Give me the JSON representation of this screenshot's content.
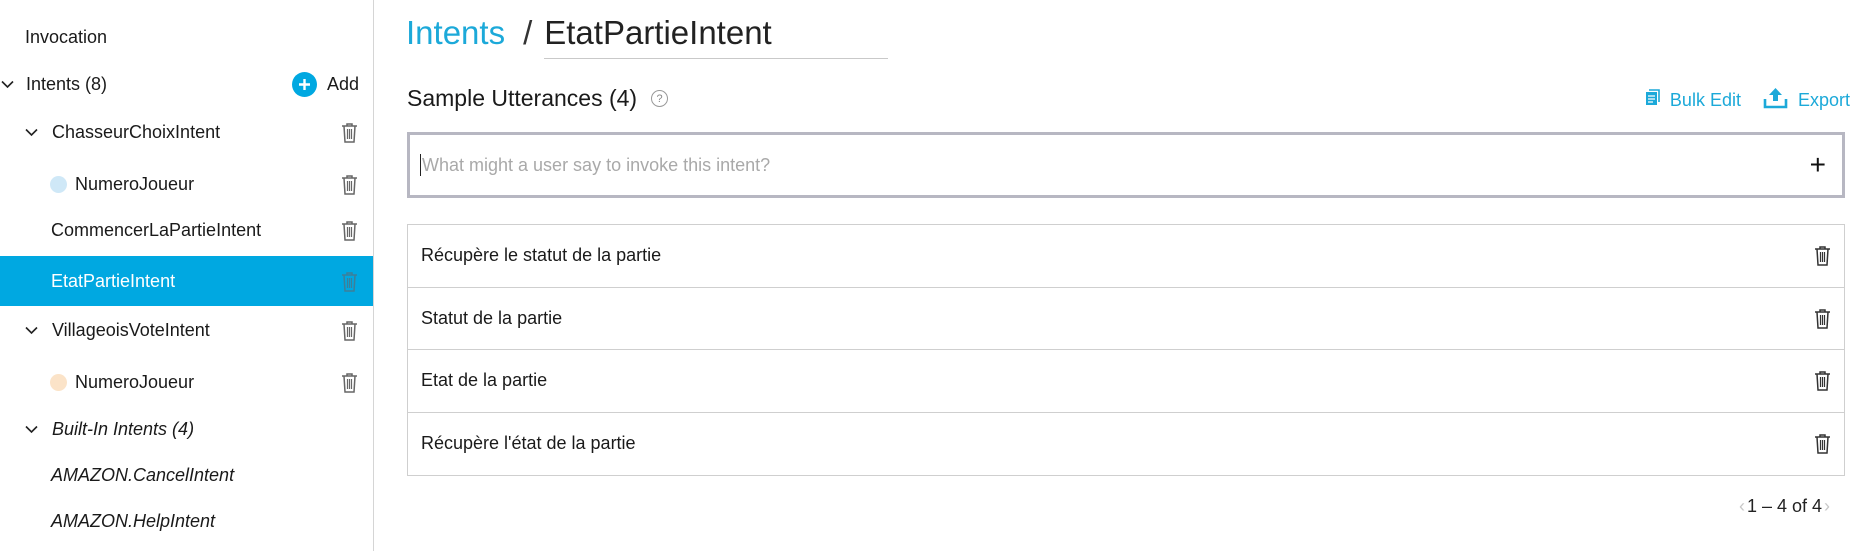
{
  "sidebar": {
    "invocation_label": "Invocation",
    "intents_label": "Intents (8)",
    "add_label": "Add",
    "items": [
      {
        "label": "ChasseurChoixIntent"
      },
      {
        "label": "NumeroJoueur",
        "slot_color": "#cfe8f7"
      },
      {
        "label": "CommencerLaPartieIntent"
      },
      {
        "label": "EtatPartieIntent"
      },
      {
        "label": "VillageoisVoteIntent"
      },
      {
        "label": "NumeroJoueur",
        "slot_color": "#fbe3c8"
      }
    ],
    "builtin_label": "Built-In Intents (4)",
    "builtin_items": [
      {
        "label": "AMAZON.CancelIntent"
      },
      {
        "label": "AMAZON.HelpIntent"
      }
    ]
  },
  "header": {
    "breadcrumb_link": "Intents",
    "breadcrumb_separator": "/",
    "intent_name": "EtatPartieIntent"
  },
  "utterances": {
    "title": "Sample Utterances (4)",
    "help_icon": "?",
    "bulk_edit_label": "Bulk Edit",
    "export_label": "Export",
    "input_placeholder": "What might a user say to invoke this intent?",
    "input_value": "",
    "add_icon": "+",
    "rows": [
      {
        "text": "Récupère le statut de la partie"
      },
      {
        "text": "Statut de la partie"
      },
      {
        "text": "Etat de la partie"
      },
      {
        "text": "Récupère l'état de la partie"
      }
    ],
    "pagination": "1 – 4 of 4",
    "prev_icon": "‹",
    "next_icon": "›"
  },
  "colors": {
    "accent": "#00a8e1",
    "link": "#1ca9d9"
  }
}
